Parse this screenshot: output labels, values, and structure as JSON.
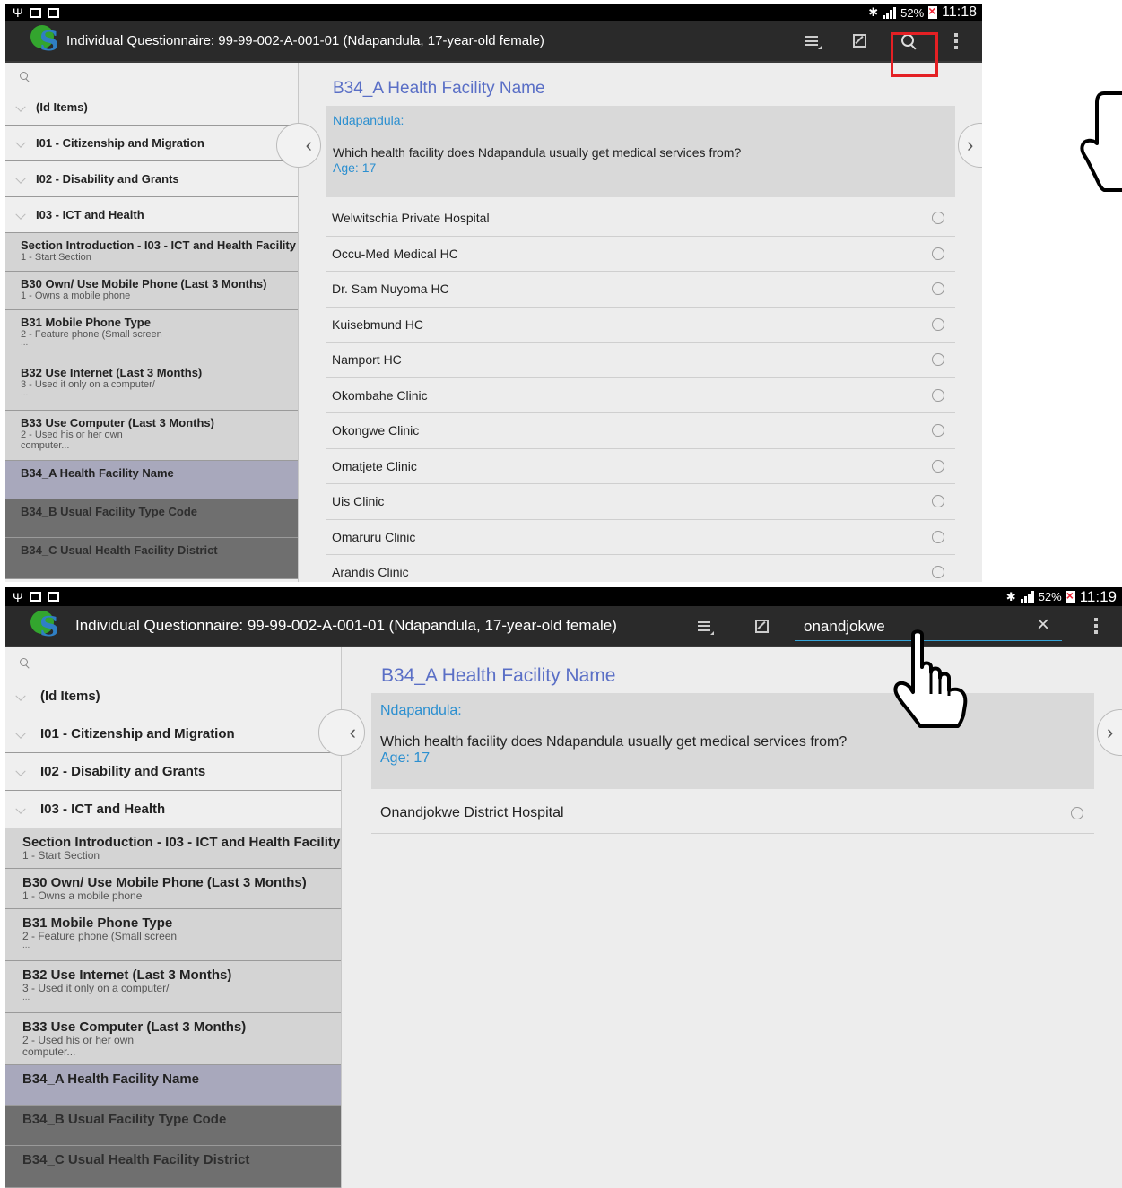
{
  "top": {
    "status": {
      "usb": "Ψ",
      "signal_pct": "52%",
      "time": "11:18"
    },
    "title": "Individual Questionnaire: 99-99-002-A-001-01 (Ndapandula, 17-year-old female)",
    "icons": [
      "list-icon",
      "edit-icon",
      "search-icon",
      "overflow-menu-icon"
    ],
    "sidebar": {
      "groups": [
        "(Id Items)",
        "I01 - Citizenship and Migration",
        "I02 - Disability and Grants",
        "I03 - ICT and Health"
      ],
      "items": [
        {
          "title": "Section Introduction - I03 - ICT and Health Facility",
          "sub": "1 - Start Section",
          "more": ""
        },
        {
          "title": "B30 Own/ Use Mobile Phone (Last 3 Months)",
          "sub": "1 - Owns a mobile phone",
          "more": ""
        },
        {
          "title": "B31 Mobile Phone Type",
          "sub": "2 - Feature phone (Small screen",
          "more": "..."
        },
        {
          "title": "B32 Use Internet (Last 3 Months)",
          "sub": "3 - Used it only on a computer/",
          "more": "..."
        },
        {
          "title": "B33 Use Computer (Last 3 Months)",
          "sub": "2 - Used his or her own",
          "more": "computer..."
        },
        {
          "title": "B34_A Health Facility Name",
          "sub": "",
          "more": ""
        },
        {
          "title": "B34_B Usual Facility Type Code",
          "sub": "",
          "more": ""
        },
        {
          "title": "B34_C Usual Health Facility District",
          "sub": "",
          "more": ""
        }
      ]
    },
    "question": {
      "title": "B34_A Health Facility Name",
      "respondent": "Ndapandula:",
      "text": "Which health facility does Ndapandula usually get medical services from?",
      "age": "Age: 17"
    },
    "options": [
      "Welwitschia Private Hospital",
      "Occu-Med Medical HC",
      "Dr. Sam Nuyoma HC",
      "Kuisebmund HC",
      "Namport HC",
      "Okombahe Clinic",
      "Okongwe Clinic",
      "Omatjete Clinic",
      "Uis Clinic",
      "Omaruru Clinic",
      "Arandis Clinic"
    ]
  },
  "bottom": {
    "status": {
      "usb": "Ψ",
      "signal_pct": "52%",
      "time": "11:19"
    },
    "title": "Individual Questionnaire: 99-99-002-A-001-01 (Ndapandula, 17-year-old female)",
    "search": {
      "value": "onandjokwe",
      "clear": "×"
    },
    "sidebar": {
      "groups": [
        "(Id Items)",
        "I01 - Citizenship and Migration",
        "I02 - Disability and Grants",
        "I03 - ICT and Health"
      ],
      "items": [
        {
          "title": "Section Introduction - I03 - ICT and Health Facility",
          "sub": "1 - Start Section",
          "more": ""
        },
        {
          "title": "B30 Own/ Use Mobile Phone (Last 3 Months)",
          "sub": "1 - Owns a mobile phone",
          "more": ""
        },
        {
          "title": "B31 Mobile Phone Type",
          "sub": "2 - Feature phone (Small screen",
          "more": "..."
        },
        {
          "title": "B32 Use Internet (Last 3 Months)",
          "sub": "3 - Used it only on a computer/",
          "more": "..."
        },
        {
          "title": "B33 Use Computer (Last 3 Months)",
          "sub": "2 - Used his or her own",
          "more": "computer..."
        },
        {
          "title": "B34_A Health Facility Name",
          "sub": "",
          "more": ""
        },
        {
          "title": "B34_B Usual Facility Type Code",
          "sub": "",
          "more": ""
        },
        {
          "title": "B34_C Usual Health Facility District",
          "sub": "",
          "more": ""
        }
      ]
    },
    "question": {
      "title": "B34_A Health Facility Name",
      "respondent": "Ndapandula:",
      "text": "Which health facility does Ndapandula usually get medical services from?",
      "age": "Age: 17"
    },
    "options": [
      "Onandjokwe District Hospital"
    ]
  },
  "colors": {
    "question_title": "#5a6fc6",
    "respondent": "#2b8fd0",
    "highlight_box": "#e42024",
    "search_underline": "#36a4d8",
    "current_item": "#a8a8bc"
  },
  "annotations": [
    "hand-point-up-icon",
    "hand-pointer-icon"
  ]
}
